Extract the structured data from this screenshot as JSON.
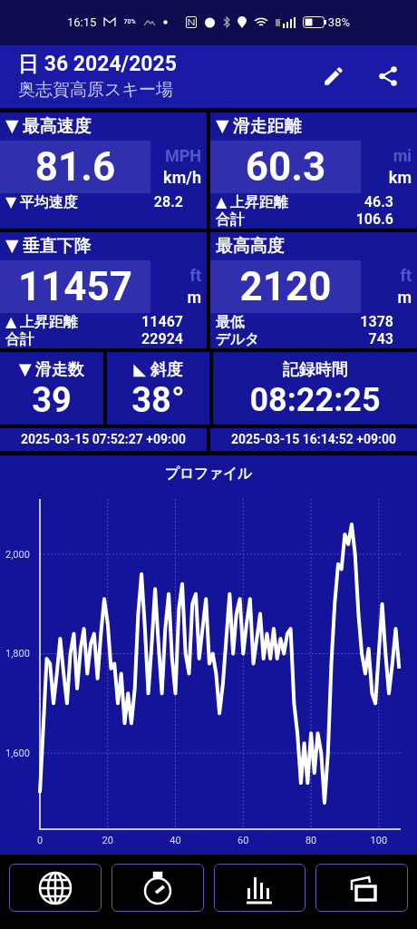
{
  "status_bar": {
    "time": "16:15",
    "weather_badge": "70%",
    "battery_text": "38%"
  },
  "header": {
    "title": "日 36 2024/2025",
    "subtitle": "奥志賀高原スキー場"
  },
  "stats": [
    {
      "label": "▼ 最高速度",
      "value": "81.6",
      "units": [
        {
          "label": "MPH",
          "selected": false
        },
        {
          "label": "km/h",
          "selected": true
        }
      ],
      "rows": [
        {
          "label": "▼ 平均速度",
          "value": "28.2"
        }
      ]
    },
    {
      "label": "▼ 滑走距離",
      "value": "60.3",
      "units": [
        {
          "label": "mi",
          "selected": false
        },
        {
          "label": "km",
          "selected": true
        }
      ],
      "rows": [
        {
          "label": "▲ 上昇距離",
          "value": "46.3"
        },
        {
          "label": "合計",
          "value": "106.6"
        }
      ]
    },
    {
      "label": "▼ 垂直下降",
      "value": "11457",
      "units": [
        {
          "label": "ft",
          "selected": false
        },
        {
          "label": "m",
          "selected": true
        }
      ],
      "rows": [
        {
          "label": "▲ 上昇距離",
          "value": "11467"
        },
        {
          "label": "合計",
          "value": "22924"
        }
      ]
    },
    {
      "label": "最高高度",
      "value": "2120",
      "units": [
        {
          "label": "ft",
          "selected": false
        },
        {
          "label": "m",
          "selected": true
        }
      ],
      "rows": [
        {
          "label": "最低",
          "value": "1378"
        },
        {
          "label": "デルタ",
          "value": "743"
        }
      ]
    }
  ],
  "small_stats": [
    {
      "label": "▼ 滑走数",
      "value": "39"
    },
    {
      "label": "◣ 斜度",
      "value": "38°"
    }
  ],
  "duration": {
    "label": "記録時間",
    "value": "08:22:25"
  },
  "times": [
    "2025-03-15 07:52:27 +09:00",
    "2025-03-15 16:14:52 +09:00"
  ],
  "profile": {
    "chart_data": {
      "type": "line",
      "title": "プロファイル",
      "grid": true,
      "xlim": [
        0,
        107
      ],
      "x": [
        0,
        1,
        2,
        3,
        4,
        5,
        6,
        7,
        8,
        9,
        10,
        11,
        12,
        13,
        14,
        15,
        16,
        17,
        18,
        19,
        20,
        21,
        22,
        23,
        24,
        25,
        26,
        27,
        28,
        29,
        30,
        31,
        32,
        33,
        34,
        35,
        36,
        37,
        38,
        39,
        40,
        41,
        42,
        43,
        44,
        45,
        46,
        47,
        48,
        49,
        50,
        51,
        52,
        53,
        54,
        55,
        56,
        57,
        58,
        59,
        60,
        61,
        62,
        63,
        64,
        65,
        66,
        67,
        68,
        69,
        70,
        71,
        72,
        73,
        74,
        75,
        76,
        77,
        78,
        79,
        80,
        81,
        82,
        83,
        84,
        85,
        86,
        87,
        88,
        89,
        90,
        91,
        92,
        93,
        94,
        95,
        96,
        97,
        98,
        99,
        100,
        101,
        102,
        103,
        104,
        105,
        106
      ],
      "ylim": [
        1447,
        2111
      ],
      "xticks": [
        0,
        20,
        40,
        60,
        80,
        100
      ],
      "yticks": [
        {
          "value": 1600,
          "label": "1,600"
        },
        {
          "value": 1800,
          "label": "1,800"
        },
        {
          "value": 2000,
          "label": "2,000"
        }
      ],
      "series": [
        {
          "color": "#ffffff",
          "values": [
            1520,
            1650,
            1790,
            1780,
            1700,
            1760,
            1830,
            1760,
            1700,
            1800,
            1840,
            1730,
            1810,
            1850,
            1760,
            1820,
            1840,
            1750,
            1840,
            1910,
            1860,
            1770,
            1780,
            1700,
            1760,
            1660,
            1720,
            1660,
            1730,
            1880,
            1960,
            1850,
            1720,
            1820,
            1930,
            1820,
            1720,
            1850,
            1920,
            1790,
            1720,
            1890,
            1940,
            1800,
            1760,
            1900,
            1920,
            1790,
            1850,
            1910,
            1780,
            1800,
            1760,
            1680,
            1740,
            1830,
            1920,
            1800,
            1880,
            1910,
            1800,
            1860,
            1910,
            1780,
            1830,
            1880,
            1790,
            1840,
            1790,
            1850,
            1790,
            1830,
            1800,
            1840,
            1850,
            1700,
            1640,
            1540,
            1620,
            1540,
            1640,
            1560,
            1640,
            1600,
            1500,
            1600,
            1780,
            1900,
            1980,
            1970,
            2040,
            2020,
            2060,
            2000,
            1880,
            1800,
            1760,
            1810,
            1720,
            1700,
            1800,
            1900,
            1800,
            1720,
            1780,
            1850,
            1770
          ]
        }
      ]
    }
  },
  "nav": [
    {
      "kind": "globe"
    },
    {
      "kind": "stopwatch"
    },
    {
      "kind": "bars"
    },
    {
      "kind": "photos"
    }
  ]
}
